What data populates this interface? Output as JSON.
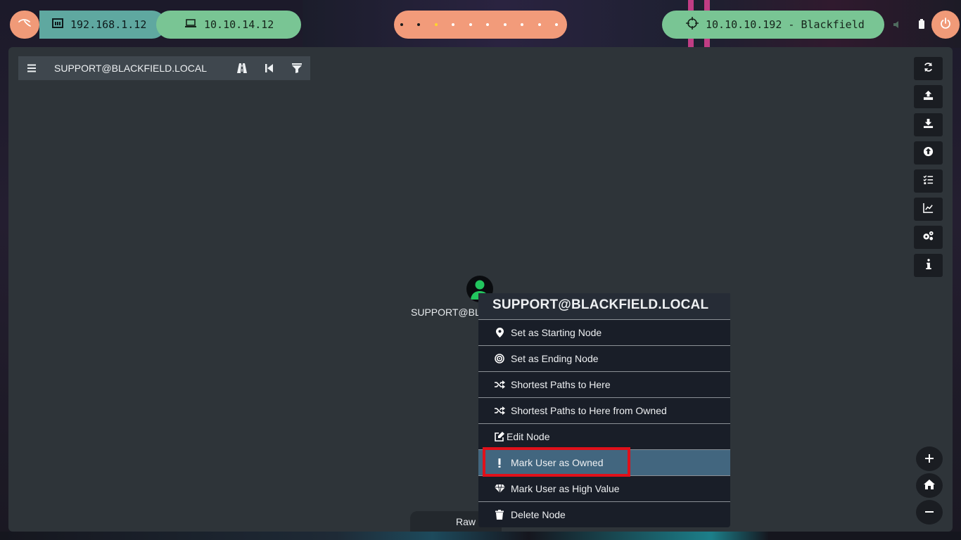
{
  "taskbar": {
    "interfaces": [
      {
        "name": "lan",
        "ip": "192.168.1.12"
      },
      {
        "name": "vpn",
        "ip": "10.10.14.12"
      }
    ],
    "workspaces": 10,
    "active_workspace": 3,
    "target": "10.10.10.192 - Blackfield"
  },
  "app": {
    "search": {
      "query": "SUPPORT@BLACKFIELD.LOCAL"
    },
    "toolbar_buttons": [
      "refresh-icon",
      "upload-icon",
      "download-icon",
      "import-icon",
      "queries-icon",
      "graph-icon",
      "settings-icon",
      "info-icon"
    ],
    "zoom": {
      "in": "+",
      "out": "−"
    },
    "graph": {
      "node": {
        "label": "SUPPORT@BLA",
        "type": "user",
        "color": "#22c55e"
      }
    },
    "raw_tab": "Raw"
  },
  "context_menu": {
    "title": "SUPPORT@BLACKFIELD.LOCAL",
    "items": [
      {
        "label": "Set as Starting Node",
        "icon": "map-marker-icon"
      },
      {
        "label": "Set as Ending Node",
        "icon": "target-icon"
      },
      {
        "label": "Shortest Paths to Here",
        "icon": "shuffle-icon"
      },
      {
        "label": "Shortest Paths to Here from Owned",
        "icon": "shuffle-icon"
      },
      {
        "label": "Edit Node",
        "icon": "edit-icon"
      },
      {
        "label": "Mark User as Owned",
        "icon": "exclamation-icon",
        "highlighted": true
      },
      {
        "label": "Mark User as High Value",
        "icon": "diamond-icon"
      },
      {
        "label": "Delete Node",
        "icon": "trash-icon"
      }
    ]
  },
  "colors": {
    "accent_green": "#79c594",
    "accent_orange": "#f09a78",
    "highlight": "#e0101a",
    "menu_selected": "#42667f"
  }
}
